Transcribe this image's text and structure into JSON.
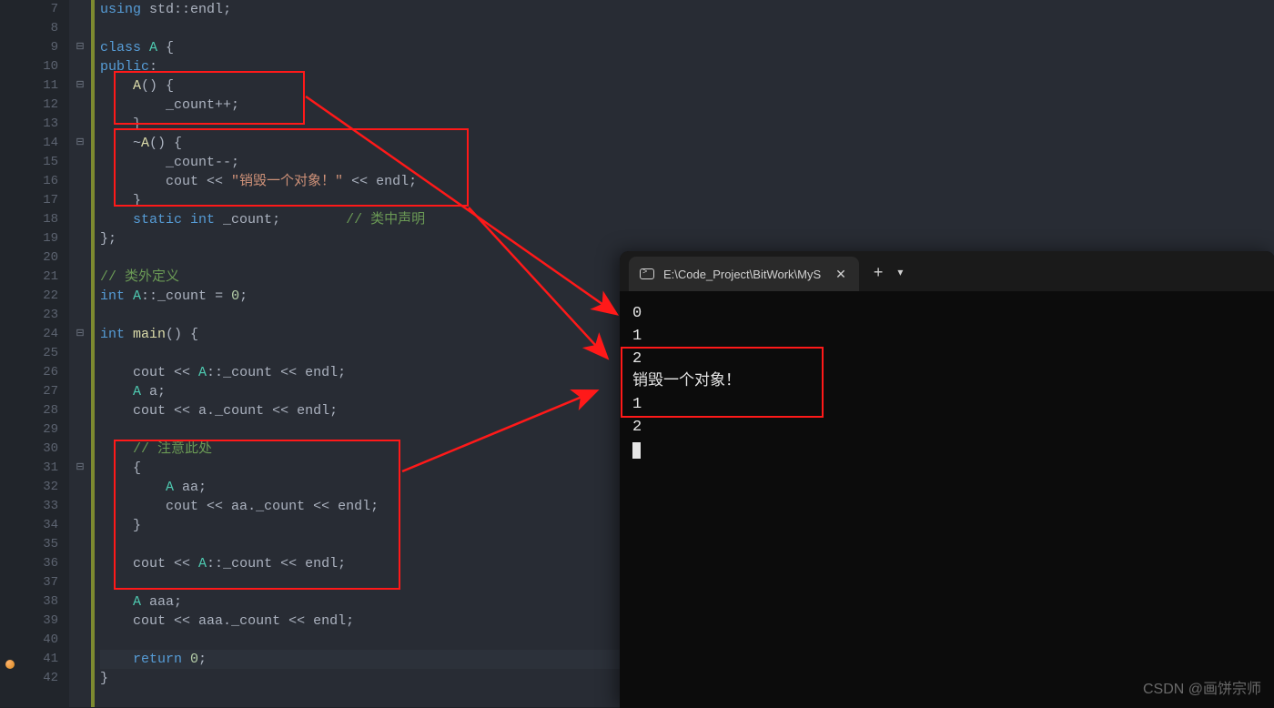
{
  "gutter": {
    "lines": [
      "7",
      "8",
      "9",
      "10",
      "11",
      "12",
      "13",
      "14",
      "15",
      "16",
      "17",
      "18",
      "19",
      "20",
      "21",
      "22",
      "23",
      "24",
      "25",
      "26",
      "27",
      "28",
      "29",
      "30",
      "31",
      "32",
      "33",
      "34",
      "35",
      "36",
      "37",
      "38",
      "39",
      "40",
      "41",
      "42"
    ]
  },
  "fold": {
    "icons": [
      "",
      "",
      "⊟",
      "",
      "⊟",
      "",
      "",
      "⊟",
      "",
      "",
      "",
      "",
      "",
      "",
      "",
      "",
      "",
      "⊟",
      "",
      "",
      "",
      "",
      "",
      "",
      "⊟",
      "",
      "",
      "",
      "",
      "",
      "",
      "",
      "",
      "",
      "",
      ""
    ]
  },
  "code": {
    "l7": {
      "t1": "using ",
      "t2": "std",
      "t3": "::",
      "t4": "endl",
      "t5": ";"
    },
    "l9": {
      "t1": "class ",
      "t2": "A ",
      "t3": "{"
    },
    "l10": {
      "t1": "public",
      "t2": ":"
    },
    "l11": {
      "t1": "    A",
      "t2": "() {"
    },
    "l12": {
      "t1": "        _count",
      "t2": "++;"
    },
    "l13": {
      "t1": "    }"
    },
    "l14": {
      "t1": "    ~",
      "t2": "A",
      "t3": "() {"
    },
    "l15": {
      "t1": "        _count",
      "t2": "--;"
    },
    "l16": {
      "t1": "        cout ",
      "t2": "<< ",
      "t3": "\"销毁一个对象！\" ",
      "t4": "<< ",
      "t5": "endl",
      "t6": ";"
    },
    "l17": {
      "t1": "    }"
    },
    "l18": {
      "t1": "    static ",
      "t2": "int ",
      "t3": "_count",
      "t4": ";        ",
      "t5": "// 类中声明"
    },
    "l19": {
      "t1": "};"
    },
    "l21": {
      "t1": "// 类外定义"
    },
    "l22": {
      "t1": "int ",
      "t2": "A",
      "t3": "::",
      "t4": "_count ",
      "t5": "= ",
      "t6": "0",
      "t7": ";"
    },
    "l24": {
      "t1": "int ",
      "t2": "main",
      "t3": "() {"
    },
    "l26": {
      "t1": "    cout ",
      "t2": "<< ",
      "t3": "A",
      "t4": "::",
      "t5": "_count ",
      "t6": "<< ",
      "t7": "endl",
      "t8": ";"
    },
    "l27": {
      "t1": "    A ",
      "t2": "a",
      "t3": ";"
    },
    "l28": {
      "t1": "    cout ",
      "t2": "<< ",
      "t3": "a",
      "t4": ".",
      "t5": "_count ",
      "t6": "<< ",
      "t7": "endl",
      "t8": ";"
    },
    "l30": {
      "t1": "    ",
      "t2": "// 注意此处"
    },
    "l31": {
      "t1": "    {"
    },
    "l32": {
      "t1": "        A ",
      "t2": "aa",
      "t3": ";"
    },
    "l33": {
      "t1": "        cout ",
      "t2": "<< ",
      "t3": "aa",
      "t4": ".",
      "t5": "_count ",
      "t6": "<< ",
      "t7": "endl",
      "t8": ";"
    },
    "l34": {
      "t1": "    }"
    },
    "l36": {
      "t1": "    cout ",
      "t2": "<< ",
      "t3": "A",
      "t4": "::",
      "t5": "_count ",
      "t6": "<< ",
      "t7": "endl",
      "t8": ";"
    },
    "l38": {
      "t1": "    A ",
      "t2": "aaa",
      "t3": ";"
    },
    "l39": {
      "t1": "    cout ",
      "t2": "<< ",
      "t3": "aaa",
      "t4": ".",
      "t5": "_count ",
      "t6": "<< ",
      "t7": "endl",
      "t8": ";"
    },
    "l41": {
      "t1": "    return ",
      "t2": "0",
      "t3": ";"
    },
    "l42": {
      "t1": "}"
    }
  },
  "terminal": {
    "tab_title": "E:\\Code_Project\\BitWork\\MyS",
    "output": [
      "0",
      "1",
      "2",
      "销毁一个对象！",
      "1",
      "2"
    ]
  },
  "watermark": "CSDN @画饼宗师"
}
